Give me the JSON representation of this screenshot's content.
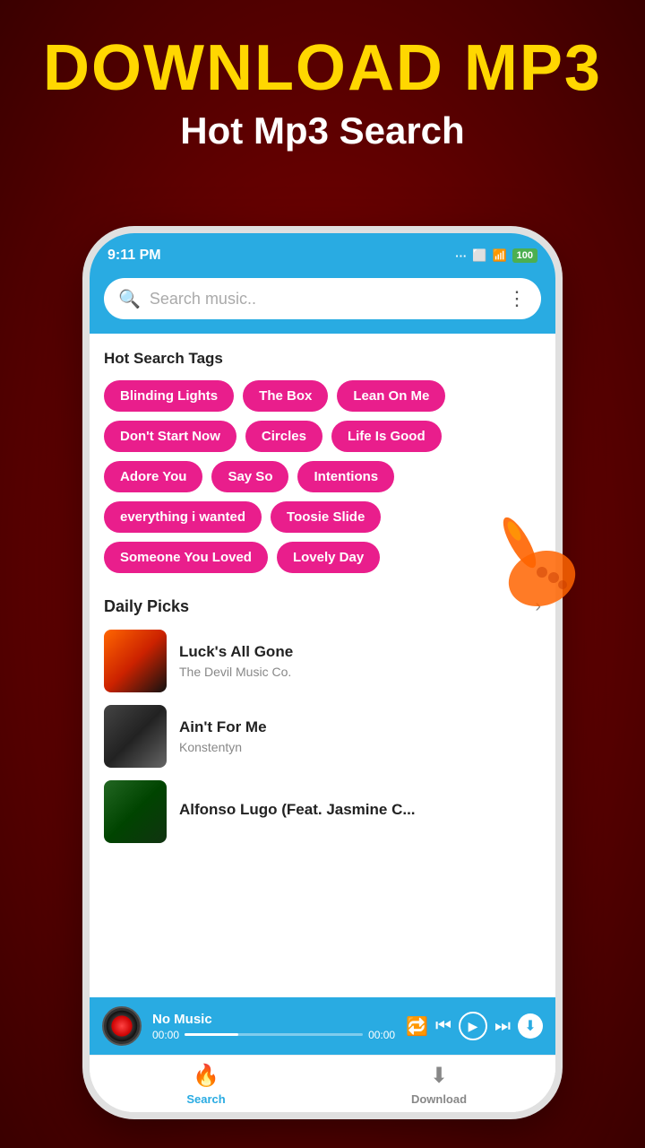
{
  "header": {
    "title": "DOWNLOAD MP3",
    "subtitle": "Hot Mp3 Search"
  },
  "status_bar": {
    "time": "9:11 PM",
    "dots": "...",
    "wifi": "WiFi",
    "battery": "100"
  },
  "search": {
    "placeholder": "Search music.."
  },
  "hot_tags": {
    "title": "Hot Search Tags",
    "tags": [
      "Blinding Lights",
      "The Box",
      "Lean On Me",
      "Don't Start Now",
      "Circles",
      "Life Is Good",
      "Adore You",
      "Say So",
      "Intentions",
      "everything i wanted",
      "Toosie Slide",
      "Someone You Loved",
      "Lovely Day"
    ]
  },
  "daily_picks": {
    "title": "Daily Picks",
    "more_label": "›",
    "songs": [
      {
        "name": "Luck's All Gone",
        "artist": "The Devil Music Co."
      },
      {
        "name": "Ain't For Me",
        "artist": "Konstentyn"
      },
      {
        "name": "Alfonso Lugo (Feat. Jasmine C...",
        "artist": ""
      }
    ]
  },
  "now_playing": {
    "title": "No Music",
    "time_start": "00:00",
    "time_end": "00:00"
  },
  "bottom_nav": {
    "items": [
      {
        "label": "Search",
        "active": true
      },
      {
        "label": "Download",
        "active": false
      }
    ]
  }
}
